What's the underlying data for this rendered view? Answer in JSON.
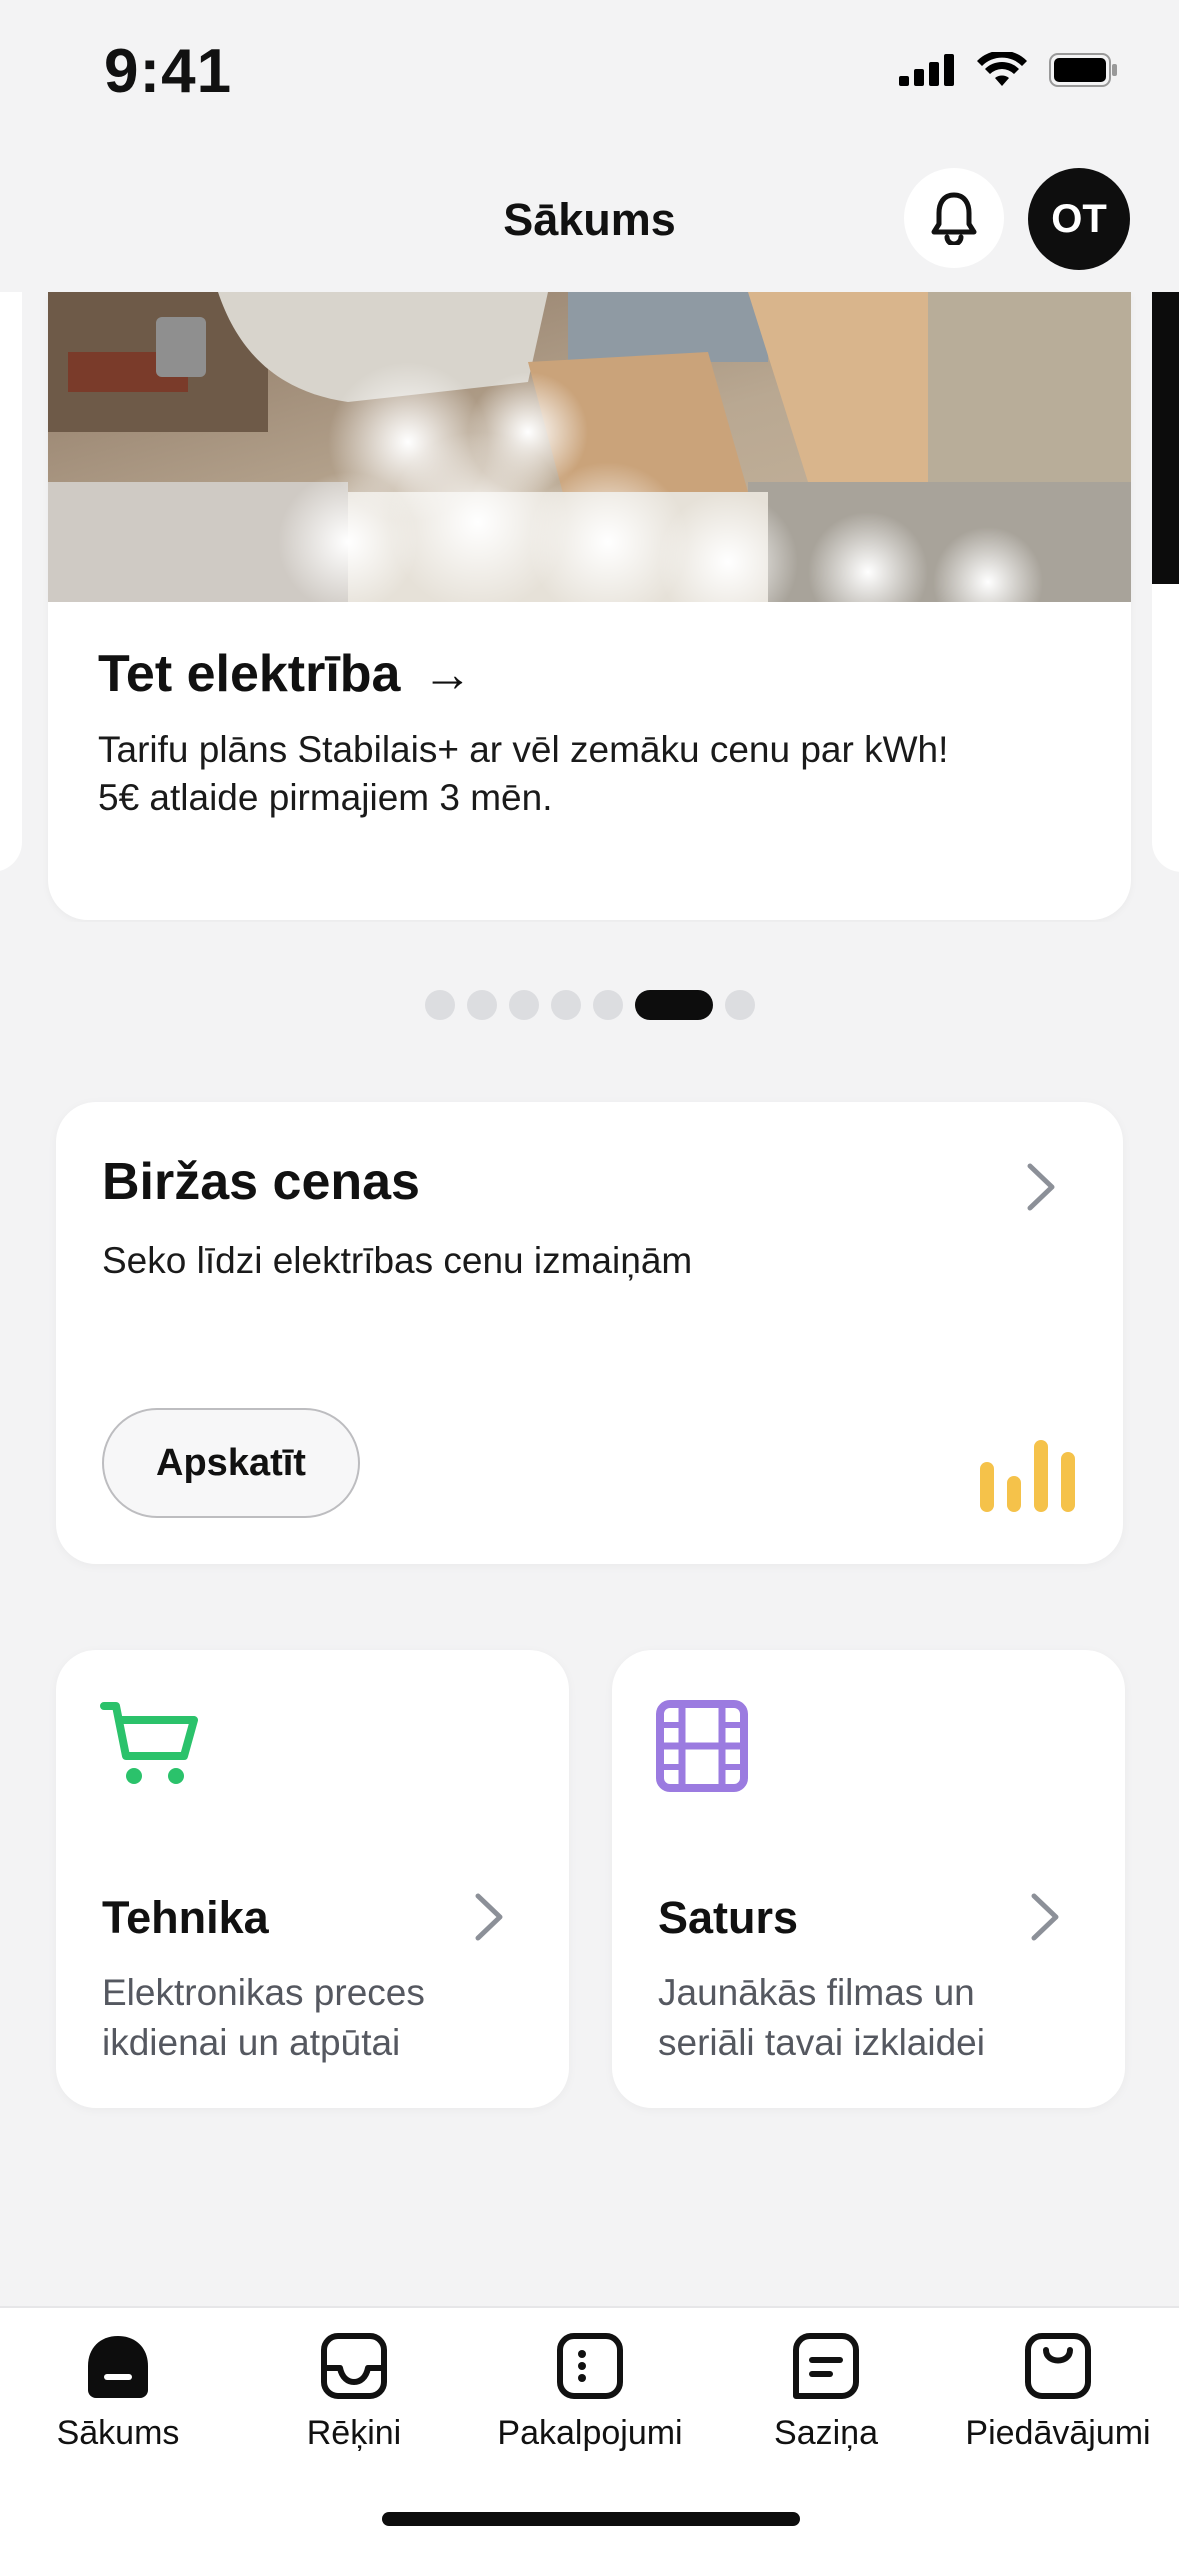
{
  "status_bar": {
    "time": "9:41"
  },
  "header": {
    "title": "Sākums",
    "avatar_initials": "OT"
  },
  "promo": {
    "title": "Tet elektrība",
    "arrow": "→",
    "text_line1": "Tarifu plāns Stabilais+ ar vēl zemāku cenu par kWh!",
    "text_line2": "5€ atlaide pirmajiem 3 mēn.",
    "page_count": 7,
    "active_page": 6
  },
  "market": {
    "title": "Biržas cenas",
    "subtitle": "Seko līdzi elektrības cenu izmaiņām",
    "button_label": "Apskatīt",
    "accent": "#f5c24a"
  },
  "tiles": [
    {
      "title": "Tehnika",
      "desc_line1": "Elektronikas preces",
      "desc_line2": "ikdienai un atpūtai",
      "icon": "cart-icon",
      "accent": "#2bc26b"
    },
    {
      "title": "Saturs",
      "desc_line1": "Jaunākās filmas un",
      "desc_line2": "seriāli tavai izklaidei",
      "icon": "film-icon",
      "accent": "#9b7be0"
    }
  ],
  "tab_bar": {
    "items": [
      {
        "label": "Sākums",
        "icon": "home-icon",
        "active": true
      },
      {
        "label": "Rēķini",
        "icon": "inbox-icon"
      },
      {
        "label": "Pakalpojumi",
        "icon": "services-icon"
      },
      {
        "label": "Saziņa",
        "icon": "chat-icon"
      },
      {
        "label": "Piedāvājumi",
        "icon": "bag-icon"
      }
    ]
  }
}
